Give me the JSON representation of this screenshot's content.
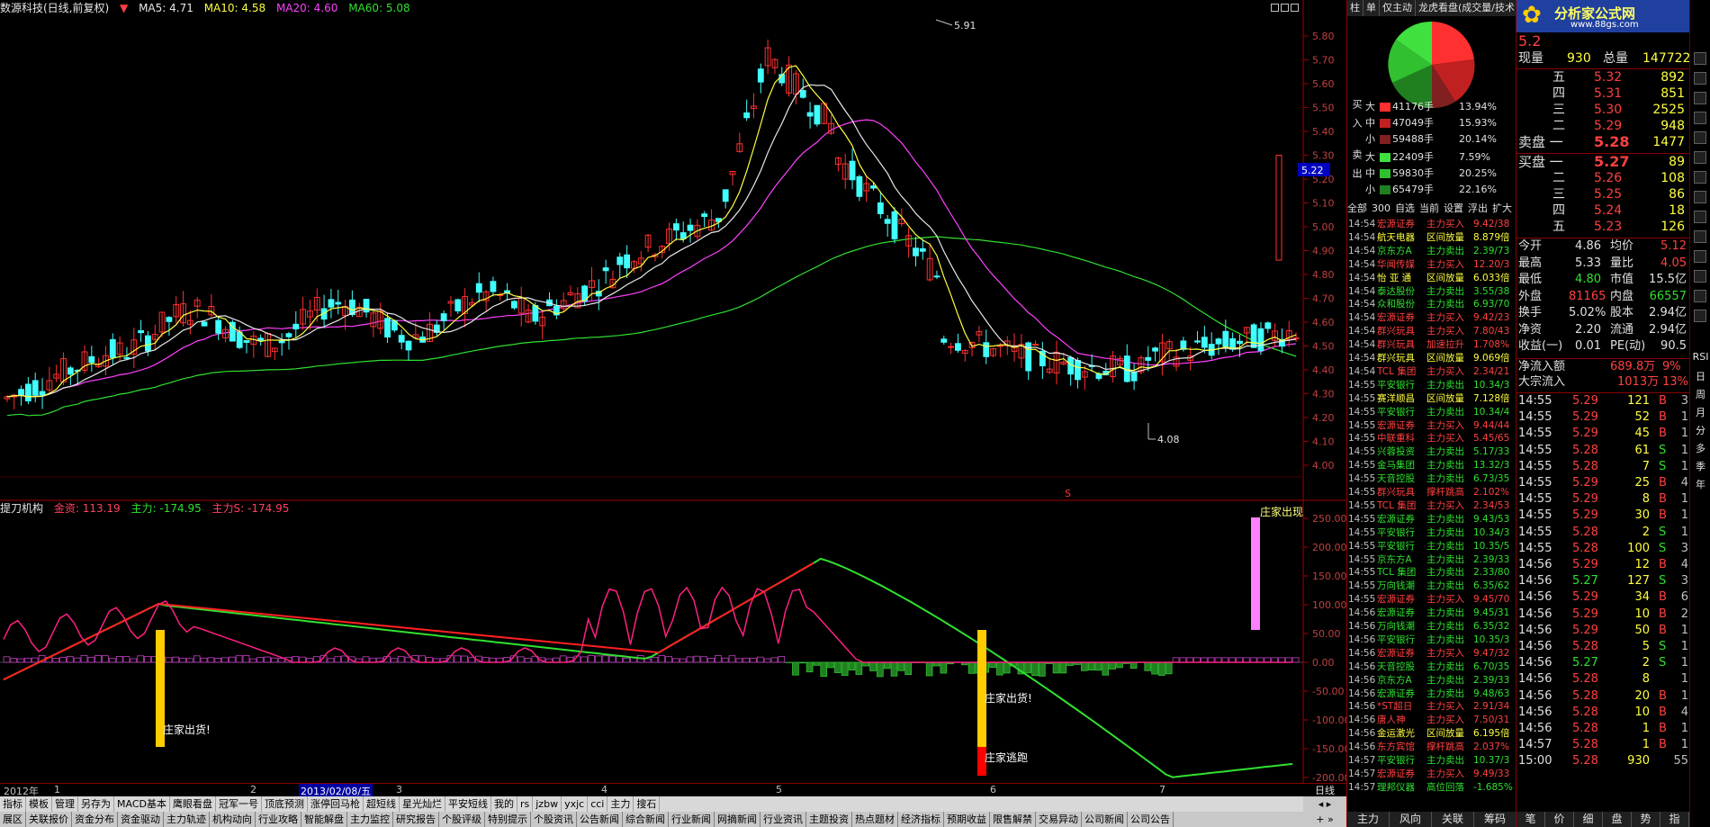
{
  "title_bar": {
    "stock_label": "数源科技(日线,前复权)",
    "ma5": "MA5: 4.71",
    "ma10": "MA10: 4.58",
    "ma20": "MA20: 4.60",
    "ma60": "MA60: 5.08",
    "colors": {
      "ma5": "#ffff40",
      "ma10": "#e8e8e8",
      "ma20": "#ff40ff",
      "ma60": "#30e030"
    }
  },
  "indicator_title": {
    "name": "提刀机构",
    "gold": "金资: 113.19",
    "main": "主力: -174.95",
    "main_s": "主力S: -174.95"
  },
  "price_axis": [
    "5.80",
    "5.70",
    "5.60",
    "5.50",
    "5.40",
    "5.30",
    "5.20",
    "5.10",
    "5.00",
    "4.90",
    "4.80",
    "4.70",
    "4.60",
    "4.50",
    "4.40",
    "4.30",
    "4.20",
    "4.10",
    "4.00"
  ],
  "price_current": "5.22",
  "price_high_label": "5.91",
  "price_low_label": "4.08",
  "indicator_axis": [
    "250.00",
    "200.00",
    "150.00",
    "100.00",
    "50.00",
    "0.00",
    "-50.00",
    "-100.00",
    "-150.00",
    "-200.00"
  ],
  "annotations": {
    "zhuangjia_chuhuo_1": "庄家出货!",
    "zhuangjia_chuhuo_2": "庄家出货!",
    "zhuangjia_taopao": "庄家逃跑",
    "zhuangjia_chuxian": "庄家出现",
    "s_marker": "S"
  },
  "date_bar": {
    "year": "2012年",
    "m1": "1",
    "m2": "2",
    "highlight": "2013/02/08/五",
    "m3": "3",
    "m4": "4",
    "m5": "5",
    "m6": "6",
    "m7": "7",
    "period": "日线"
  },
  "toolbar1": [
    "指标",
    "模板",
    "管理",
    "另存为",
    "MACD基本",
    "鹰眼看盘",
    "冠军一号",
    "顶底预测",
    "涨停回马枪",
    "超短线",
    "星光灿烂",
    "平安短线",
    "我的",
    "rs",
    "jzbw",
    "yxjc",
    "cci",
    "主力",
    "搜石"
  ],
  "toolbar2": [
    "展区",
    "关联报价",
    "资金分布",
    "资金驱动",
    "主力轨迹",
    "机构动向",
    "行业攻略",
    "智能解盘",
    "主力监控",
    "研究报告",
    "个股评级",
    "特别提示",
    "个股资讯",
    "公告新闻",
    "综合新闻",
    "行业新闻",
    "网摘新闻",
    "行业资讯",
    "主题投资",
    "热点题材",
    "经济指标",
    "预期收益",
    "限售解禁",
    "交易异动",
    "公司新闻",
    "公司公告"
  ],
  "mid_tabs": [
    "柱",
    "单",
    "仅主动",
    "龙虎看盘(成交量/技术"
  ],
  "flows": {
    "buy_label": "买入",
    "sell_label": "卖出",
    "buy": [
      {
        "size": "大",
        "vol": "41176手",
        "pct": "13.94%"
      },
      {
        "size": "中",
        "vol": "47049手",
        "pct": "15.93%"
      },
      {
        "size": "小",
        "vol": "59488手",
        "pct": "20.14%"
      }
    ],
    "sell": [
      {
        "size": "大",
        "vol": "22409手",
        "pct": "7.59%"
      },
      {
        "size": "中",
        "vol": "59830手",
        "pct": "20.25%"
      },
      {
        "size": "小",
        "vol": "65479手",
        "pct": "22.16%"
      }
    ]
  },
  "filter_bar": [
    "全部",
    "300",
    "自选",
    "当前",
    "设置",
    "浮出",
    "扩大"
  ],
  "news": [
    {
      "t": "14:54",
      "name": "宏源证券",
      "act": "主力买入",
      "val": "9.42/38"
    },
    {
      "t": "14:54",
      "name": "航天电器",
      "act": "区间放量",
      "val": "8.879倍"
    },
    {
      "t": "14:54",
      "name": "京东方A",
      "act": "主力卖出",
      "val": "2.39/73"
    },
    {
      "t": "14:54",
      "name": "华闻传媒",
      "act": "主力买入",
      "val": "12.20/3"
    },
    {
      "t": "14:54",
      "name": "怡 亚 通",
      "act": "区间放量",
      "val": "6.033倍"
    },
    {
      "t": "14:54",
      "name": "泰达股份",
      "act": "主力卖出",
      "val": "3.55/38"
    },
    {
      "t": "14:54",
      "name": "众和股份",
      "act": "主力卖出",
      "val": "6.93/70"
    },
    {
      "t": "14:54",
      "name": "宏源证券",
      "act": "主力买入",
      "val": "9.42/23"
    },
    {
      "t": "14:54",
      "name": "群兴玩具",
      "act": "主力买入",
      "val": "7.80/43"
    },
    {
      "t": "14:54",
      "name": "群兴玩具",
      "act": "加速拉升",
      "val": "1.708%"
    },
    {
      "t": "14:54",
      "name": "群兴玩具",
      "act": "区间放量",
      "val": "9.069倍"
    },
    {
      "t": "14:54",
      "name": "TCL 集团",
      "act": "主力买入",
      "val": "2.34/21"
    },
    {
      "t": "14:55",
      "name": "平安银行",
      "act": "主力卖出",
      "val": "10.34/3"
    },
    {
      "t": "14:55",
      "name": "赛洋顺昌",
      "act": "区间放量",
      "val": "7.128倍"
    },
    {
      "t": "14:55",
      "name": "平安银行",
      "act": "主力卖出",
      "val": "10.34/4"
    },
    {
      "t": "14:55",
      "name": "宏源证券",
      "act": "主力买入",
      "val": "9.44/44"
    },
    {
      "t": "14:55",
      "name": "中联重科",
      "act": "主力买入",
      "val": "5.45/65"
    },
    {
      "t": "14:55",
      "name": "兴蓉投资",
      "act": "主力卖出",
      "val": "5.17/33"
    },
    {
      "t": "14:55",
      "name": "金马集团",
      "act": "主力卖出",
      "val": "13.32/3"
    },
    {
      "t": "14:55",
      "name": "天音控股",
      "act": "主力卖出",
      "val": "6.73/35"
    },
    {
      "t": "14:55",
      "name": "群兴玩具",
      "act": "撑杆跳高",
      "val": "2.102%"
    },
    {
      "t": "14:55",
      "name": "TCL 集团",
      "act": "主力买入",
      "val": "2.34/53"
    },
    {
      "t": "14:55",
      "name": "宏源证券",
      "act": "主力卖出",
      "val": "9.43/53"
    },
    {
      "t": "14:55",
      "name": "平安银行",
      "act": "主力卖出",
      "val": "10.34/3"
    },
    {
      "t": "14:55",
      "name": "平安银行",
      "act": "主力卖出",
      "val": "10.35/5"
    },
    {
      "t": "14:55",
      "name": "京东方A",
      "act": "主力卖出",
      "val": "2.39/33"
    },
    {
      "t": "14:55",
      "name": "TCL 集团",
      "act": "主力卖出",
      "val": "2.33/80"
    },
    {
      "t": "14:55",
      "name": "万向钱潮",
      "act": "主力卖出",
      "val": "6.35/62"
    },
    {
      "t": "14:55",
      "name": "宏源证券",
      "act": "主力买入",
      "val": "9.45/70"
    },
    {
      "t": "14:56",
      "name": "宏源证券",
      "act": "主力卖出",
      "val": "9.45/31"
    },
    {
      "t": "14:56",
      "name": "万向钱潮",
      "act": "主力卖出",
      "val": "6.35/32"
    },
    {
      "t": "14:56",
      "name": "平安银行",
      "act": "主力卖出",
      "val": "10.35/3"
    },
    {
      "t": "14:56",
      "name": "宏源证券",
      "act": "主力买入",
      "val": "9.47/32"
    },
    {
      "t": "14:56",
      "name": "天音控股",
      "act": "主力卖出",
      "val": "6.70/35"
    },
    {
      "t": "14:56",
      "name": "京东方A",
      "act": "主力卖出",
      "val": "2.39/33"
    },
    {
      "t": "14:56",
      "name": "宏源证券",
      "act": "主力卖出",
      "val": "9.48/63"
    },
    {
      "t": "14:56",
      "name": "*ST超日",
      "act": "主力买入",
      "val": "2.91/34"
    },
    {
      "t": "14:56",
      "name": "唐人神",
      "act": "主力买入",
      "val": "7.50/31"
    },
    {
      "t": "14:56",
      "name": "金运激光",
      "act": "区间放量",
      "val": "6.195倍"
    },
    {
      "t": "14:56",
      "name": "东方宾馆",
      "act": "撑杆跳高",
      "val": "2.037%"
    },
    {
      "t": "14:57",
      "name": "平安银行",
      "act": "主力卖出",
      "val": "10.37/3"
    },
    {
      "t": "14:57",
      "name": "宏源证券",
      "act": "主力买入",
      "val": "9.49/33"
    },
    {
      "t": "14:57",
      "name": "理邦仪器",
      "act": "高位回落",
      "val": "-1.685%"
    }
  ],
  "mid_bottom_tabs": [
    "主力",
    "风向",
    "关联",
    "筹码"
  ],
  "brand": {
    "name": "分析家公式网",
    "url": "www.88gs.com"
  },
  "quote": {
    "price": "5.2",
    "xianliang_label": "现量",
    "xianliang": "930",
    "zongliang_label": "总量",
    "zongliang": "147722"
  },
  "sell_orders": [
    {
      "lvl": "五",
      "price": "5.32",
      "vol": "892"
    },
    {
      "lvl": "四",
      "price": "5.31",
      "vol": "851"
    },
    {
      "lvl": "三",
      "price": "5.30",
      "vol": "2525"
    },
    {
      "lvl": "二",
      "price": "5.29",
      "vol": "948"
    },
    {
      "lvl": "卖盘 一",
      "price": "5.28",
      "vol": "1477"
    }
  ],
  "buy_orders": [
    {
      "lvl": "买盘 一",
      "price": "5.27",
      "vol": "89"
    },
    {
      "lvl": "二",
      "price": "5.26",
      "vol": "108"
    },
    {
      "lvl": "三",
      "price": "5.25",
      "vol": "86"
    },
    {
      "lvl": "四",
      "price": "5.24",
      "vol": "18"
    },
    {
      "lvl": "五",
      "price": "5.23",
      "vol": "126"
    }
  ],
  "stats": [
    {
      "l1": "今开",
      "v1": "4.86",
      "l2": "均价",
      "v2": "5.12"
    },
    {
      "l1": "最高",
      "v1": "5.33",
      "l2": "量比",
      "v2": "4.05"
    },
    {
      "l1": "最低",
      "v1": "4.80",
      "l2": "市值",
      "v2": "15.5亿"
    },
    {
      "l1": "外盘",
      "v1": "81165",
      "l2": "内盘",
      "v2": "66557"
    },
    {
      "l1": "换手",
      "v1": "5.02%",
      "l2": "股本",
      "v2": "2.94亿"
    },
    {
      "l1": "净资",
      "v1": "2.20",
      "l2": "流通",
      "v2": "2.94亿"
    },
    {
      "l1": "收益(一)",
      "v1": "0.01",
      "l2": "PE(动)",
      "v2": "90.5"
    }
  ],
  "net_flow": {
    "label": "净流入额",
    "val": "689.8万",
    "pct": "9%"
  },
  "big_flow": {
    "label": "大宗流入",
    "val": "1013万",
    "pct": "13%"
  },
  "ticks": [
    {
      "t": "14:55",
      "p": "5.29",
      "v": "121",
      "d": "B",
      "n": "3"
    },
    {
      "t": "14:55",
      "p": "5.29",
      "v": "52",
      "d": "B",
      "n": "1"
    },
    {
      "t": "14:55",
      "p": "5.29",
      "v": "45",
      "d": "B",
      "n": "1"
    },
    {
      "t": "14:55",
      "p": "5.28",
      "v": "61",
      "d": "S",
      "n": "1"
    },
    {
      "t": "14:55",
      "p": "5.28",
      "v": "7",
      "d": "S",
      "n": "1"
    },
    {
      "t": "14:55",
      "p": "5.29",
      "v": "25",
      "d": "B",
      "n": "4"
    },
    {
      "t": "14:55",
      "p": "5.29",
      "v": "8",
      "d": "B",
      "n": "1"
    },
    {
      "t": "14:55",
      "p": "5.29",
      "v": "30",
      "d": "B",
      "n": "1"
    },
    {
      "t": "14:55",
      "p": "5.28",
      "v": "2",
      "d": "S",
      "n": "1"
    },
    {
      "t": "14:55",
      "p": "5.28",
      "v": "100",
      "d": "S",
      "n": "3"
    },
    {
      "t": "14:56",
      "p": "5.29",
      "v": "12",
      "d": "B",
      "n": "4"
    },
    {
      "t": "14:56",
      "p": "5.27",
      "v": "127",
      "d": "S",
      "n": "3"
    },
    {
      "t": "14:56",
      "p": "5.29",
      "v": "34",
      "d": "B",
      "n": "6"
    },
    {
      "t": "14:56",
      "p": "5.29",
      "v": "10",
      "d": "B",
      "n": "2"
    },
    {
      "t": "14:56",
      "p": "5.29",
      "v": "50",
      "d": "B",
      "n": "1"
    },
    {
      "t": "14:56",
      "p": "5.28",
      "v": "5",
      "d": "S",
      "n": "1"
    },
    {
      "t": "14:56",
      "p": "5.27",
      "v": "2",
      "d": "S",
      "n": "1"
    },
    {
      "t": "14:56",
      "p": "5.28",
      "v": "8",
      "d": "",
      "n": "1"
    },
    {
      "t": "14:56",
      "p": "5.28",
      "v": "20",
      "d": "B",
      "n": "1"
    },
    {
      "t": "14:56",
      "p": "5.28",
      "v": "10",
      "d": "B",
      "n": "4"
    },
    {
      "t": "14:56",
      "p": "5.28",
      "v": "1",
      "d": "B",
      "n": "1"
    },
    {
      "t": "14:57",
      "p": "5.28",
      "v": "1",
      "d": "B",
      "n": "1"
    },
    {
      "t": "15:00",
      "p": "5.28",
      "v": "930",
      "d": "",
      "n": "55"
    }
  ],
  "right_bottom_tabs": [
    "笔",
    "价",
    "细",
    "盘",
    "势",
    "指"
  ],
  "side_tabs": [
    "RSI",
    "日",
    "周",
    "月",
    "分",
    "多",
    "季",
    "年"
  ]
}
